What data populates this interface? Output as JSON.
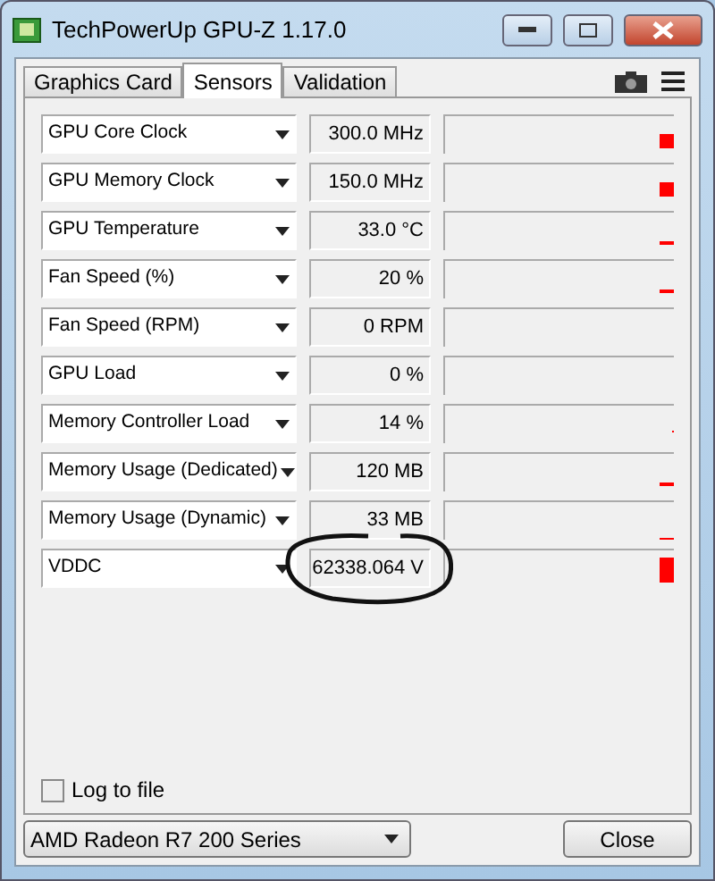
{
  "window": {
    "title": "TechPowerUp GPU-Z 1.17.0"
  },
  "tabs": [
    {
      "label": "Graphics Card",
      "selected": false
    },
    {
      "label": "Sensors",
      "selected": true
    },
    {
      "label": "Validation",
      "selected": false
    }
  ],
  "sensors": [
    {
      "name": "GPU Core Clock",
      "value": "300.0 MHz"
    },
    {
      "name": "GPU Memory Clock",
      "value": "150.0 MHz"
    },
    {
      "name": "GPU Temperature",
      "value": "33.0 °C"
    },
    {
      "name": "Fan Speed (%)",
      "value": "20 %"
    },
    {
      "name": "Fan Speed (RPM)",
      "value": "0 RPM"
    },
    {
      "name": "GPU Load",
      "value": "0 %"
    },
    {
      "name": "Memory Controller Load",
      "value": "14 %"
    },
    {
      "name": "Memory Usage (Dedicated)",
      "value": "120 MB"
    },
    {
      "name": "Memory Usage (Dynamic)",
      "value": "33 MB"
    },
    {
      "name": "VDDC",
      "value": "62338.064 V"
    }
  ],
  "log_to_file": {
    "label": "Log to file",
    "checked": false
  },
  "gpu_select": {
    "value": "AMD Radeon R7 200 Series"
  },
  "close_button": {
    "label": "Close"
  }
}
